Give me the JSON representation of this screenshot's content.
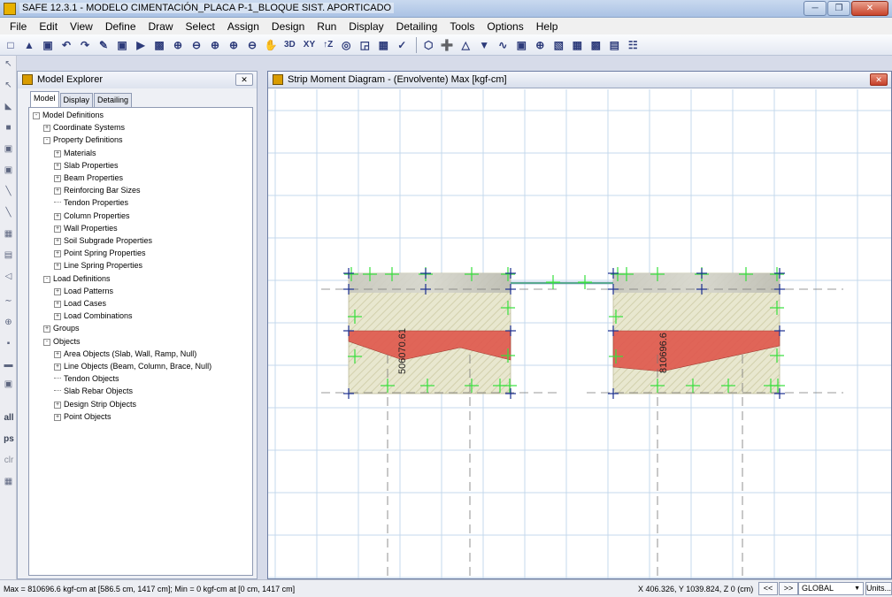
{
  "window": {
    "title": "SAFE 12.3.1 - MODELO CIMENTACIÓN_PLACA P-1_BLOQUE SIST. APORTICADO"
  },
  "menu": [
    "File",
    "Edit",
    "View",
    "Define",
    "Draw",
    "Select",
    "Assign",
    "Design",
    "Run",
    "Display",
    "Detailing",
    "Tools",
    "Options",
    "Help"
  ],
  "toolbar": {
    "view_3d": "3D",
    "view_xy": "XY",
    "view_z": "↑Z"
  },
  "left_strip": {
    "all": "all",
    "ps": "ps",
    "clr": "clr"
  },
  "explorer": {
    "title": "Model Explorer",
    "tabs": [
      "Model",
      "Display",
      "Detailing"
    ],
    "tree": [
      {
        "label": "Model Definitions",
        "level": 0,
        "expand": "-"
      },
      {
        "label": "Coordinate Systems",
        "level": 1,
        "expand": "+"
      },
      {
        "label": "Property Definitions",
        "level": 1,
        "expand": "-"
      },
      {
        "label": "Materials",
        "level": 2,
        "expand": "+"
      },
      {
        "label": "Slab Properties",
        "level": 2,
        "expand": "+"
      },
      {
        "label": "Beam Properties",
        "level": 2,
        "expand": "+"
      },
      {
        "label": "Reinforcing Bar Sizes",
        "level": 2,
        "expand": "+"
      },
      {
        "label": "Tendon Properties",
        "level": 2,
        "expand": ""
      },
      {
        "label": "Column Properties",
        "level": 2,
        "expand": "+"
      },
      {
        "label": "Wall Properties",
        "level": 2,
        "expand": "+"
      },
      {
        "label": "Soil Subgrade Properties",
        "level": 2,
        "expand": "+"
      },
      {
        "label": "Point Spring Properties",
        "level": 2,
        "expand": "+"
      },
      {
        "label": "Line Spring Properties",
        "level": 2,
        "expand": "+"
      },
      {
        "label": "Load Definitions",
        "level": 1,
        "expand": "-"
      },
      {
        "label": "Load Patterns",
        "level": 2,
        "expand": "+"
      },
      {
        "label": "Load Cases",
        "level": 2,
        "expand": "+"
      },
      {
        "label": "Load Combinations",
        "level": 2,
        "expand": "+"
      },
      {
        "label": "Groups",
        "level": 1,
        "expand": "+"
      },
      {
        "label": "Objects",
        "level": 1,
        "expand": "-"
      },
      {
        "label": "Area Objects (Slab, Wall, Ramp, Null)",
        "level": 2,
        "expand": "+"
      },
      {
        "label": "Line Objects (Beam, Column, Brace, Null)",
        "level": 2,
        "expand": "+"
      },
      {
        "label": "Tendon Objects",
        "level": 2,
        "expand": ""
      },
      {
        "label": "Slab Rebar Objects",
        "level": 2,
        "expand": ""
      },
      {
        "label": "Design Strip Objects",
        "level": 2,
        "expand": "+"
      },
      {
        "label": "Point Objects",
        "level": 2,
        "expand": "+"
      }
    ]
  },
  "viewport": {
    "title": "Strip Moment Diagram   - (Envolvente)  Max  [kgf-cm]",
    "labels": {
      "left_strip_value": "506070.61",
      "right_strip_value": "810696.6"
    },
    "colors": {
      "moment_fill": "#e05a4f",
      "slab_fill": "#e6e4cc",
      "grid": "#c4d8ec",
      "support_marker": "#36e03c",
      "point_marker": "#1b2f8f"
    }
  },
  "status": {
    "left": "Max = 810696.6 kgf-cm at [586.5 cm, 1417 cm];  Min = 0 kgf-cm at [0 cm, 1417 cm]",
    "coords": "X 406.326,  Y 1039.824,  Z 0  (cm)",
    "nav_prev": "<<",
    "nav_next": ">>",
    "coord_system": "GLOBAL",
    "units_button": "Units..."
  }
}
